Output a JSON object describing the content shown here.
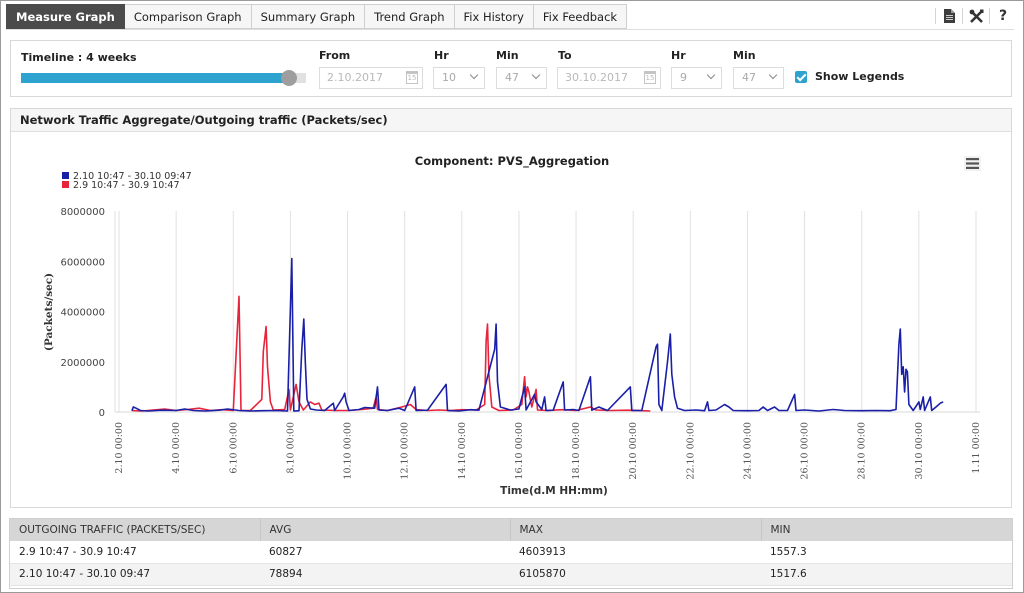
{
  "tabs": [
    {
      "label": "Measure Graph",
      "active": true
    },
    {
      "label": "Comparison Graph",
      "active": false
    },
    {
      "label": "Summary Graph",
      "active": false
    },
    {
      "label": "Trend Graph",
      "active": false
    },
    {
      "label": "Fix History",
      "active": false
    },
    {
      "label": "Fix Feedback",
      "active": false
    }
  ],
  "toolbar": {
    "icons": [
      "document-icon",
      "tools-icon",
      "help-icon"
    ],
    "help_label": "?"
  },
  "timeline": {
    "label": "Timeline : 4 weeks",
    "slider_value_fraction": 0.94,
    "from_label": "From",
    "from_date": "2.10.2017",
    "from_hr_label": "Hr",
    "from_hr": "10",
    "from_min_label": "Min",
    "from_min": "47",
    "to_label": "To",
    "to_date": "30.10.2017",
    "to_hr_label": "Hr",
    "to_hr": "9",
    "to_min_label": "Min",
    "to_min": "47",
    "calendar_day": "15",
    "show_legends_label": "Show Legends",
    "show_legends_checked": true
  },
  "panel": {
    "title": "Network Traffic Aggregate/Outgoing traffic (Packets/sec)"
  },
  "chart_data": {
    "type": "line",
    "title": "Component: PVS_Aggregation",
    "xlabel": "Time(d.M HH:mm)",
    "ylabel": "(Packets/sec)",
    "ylim": [
      0,
      8000000
    ],
    "yticks": [
      "0",
      "2000000",
      "4000000",
      "6000000",
      "8000000"
    ],
    "ytick_values": [
      0,
      2000000,
      4000000,
      6000000,
      8000000
    ],
    "xlim_days": [
      0,
      30.3
    ],
    "xticks": [
      "2.10 00:00",
      "4.10 00:00",
      "6.10 00:00",
      "8.10 00:00",
      "10.10 00:00",
      "12.10 00:00",
      "14.10 00:00",
      "16.10 00:00",
      "18.10 00:00",
      "20.10 00:00",
      "22.10 00:00",
      "24.10 00:00",
      "26.10 00:00",
      "28.10 00:00",
      "30.10 00:00",
      "1.11 00:00"
    ],
    "xtick_days": [
      0,
      2,
      4,
      6,
      8,
      10,
      12,
      14,
      16,
      18,
      20,
      22,
      24,
      26,
      28,
      30
    ],
    "grid": true,
    "legend_position": "top-left",
    "menu_icon": "hamburger-menu-icon",
    "x_units_note": "x values are days offset from 2.10 00:00 on the shared axis",
    "series": [
      {
        "name": "2.10 10:47 - 30.10 09:47",
        "color": "#1a1fa8",
        "points": [
          [
            0.45,
            50000
          ],
          [
            0.5,
            200000
          ],
          [
            0.6,
            150000
          ],
          [
            0.75,
            60000
          ],
          [
            1.0,
            40000
          ],
          [
            1.5,
            70000
          ],
          [
            2.0,
            60000
          ],
          [
            2.3,
            120000
          ],
          [
            2.6,
            60000
          ],
          [
            3.0,
            40000
          ],
          [
            3.5,
            70000
          ],
          [
            3.8,
            120000
          ],
          [
            4.2,
            60000
          ],
          [
            4.6,
            40000
          ],
          [
            5.0,
            50000
          ],
          [
            5.5,
            60000
          ],
          [
            5.9,
            40000
          ],
          [
            6.05,
            6105870
          ],
          [
            6.12,
            40000
          ],
          [
            6.3,
            50000
          ],
          [
            6.4,
            2500000
          ],
          [
            6.47,
            3700000
          ],
          [
            6.52,
            2000000
          ],
          [
            6.58,
            500000
          ],
          [
            6.7,
            120000
          ],
          [
            6.9,
            80000
          ],
          [
            7.2,
            60000
          ],
          [
            7.5,
            350000
          ],
          [
            7.55,
            60000
          ],
          [
            7.85,
            600000
          ],
          [
            7.9,
            750000
          ],
          [
            7.95,
            400000
          ],
          [
            8.05,
            60000
          ],
          [
            8.4,
            100000
          ],
          [
            8.6,
            180000
          ],
          [
            8.95,
            150000
          ],
          [
            9.05,
            1000000
          ],
          [
            9.1,
            80000
          ],
          [
            9.4,
            60000
          ],
          [
            9.8,
            150000
          ],
          [
            10.0,
            60000
          ],
          [
            10.35,
            1000000
          ],
          [
            10.4,
            60000
          ],
          [
            10.8,
            70000
          ],
          [
            11.45,
            1100000
          ],
          [
            11.5,
            60000
          ],
          [
            11.9,
            40000
          ],
          [
            12.3,
            90000
          ],
          [
            12.6,
            70000
          ],
          [
            13.15,
            2500000
          ],
          [
            13.2,
            3500000
          ],
          [
            13.25,
            1200000
          ],
          [
            13.35,
            200000
          ],
          [
            13.7,
            80000
          ],
          [
            14.0,
            120000
          ],
          [
            14.2,
            1000000
          ],
          [
            14.25,
            80000
          ],
          [
            14.45,
            500000
          ],
          [
            14.5,
            600000
          ],
          [
            14.55,
            700000
          ],
          [
            14.6,
            400000
          ],
          [
            14.8,
            100000
          ],
          [
            14.9,
            600000
          ],
          [
            14.95,
            60000
          ],
          [
            15.2,
            70000
          ],
          [
            15.55,
            1200000
          ],
          [
            15.6,
            80000
          ],
          [
            15.9,
            100000
          ],
          [
            16.1,
            60000
          ],
          [
            16.5,
            1400000
          ],
          [
            16.55,
            70000
          ],
          [
            16.8,
            200000
          ],
          [
            16.9,
            150000
          ],
          [
            17.1,
            60000
          ],
          [
            17.9,
            1000000
          ],
          [
            17.95,
            60000
          ],
          [
            18.3,
            60000
          ],
          [
            18.8,
            2600000
          ],
          [
            18.85,
            2700000
          ],
          [
            18.9,
            300000
          ],
          [
            19.0,
            60000
          ],
          [
            19.2,
            2000000
          ],
          [
            19.3,
            3100000
          ],
          [
            19.35,
            1500000
          ],
          [
            19.45,
            600000
          ],
          [
            19.55,
            150000
          ],
          [
            19.8,
            60000
          ],
          [
            20.2,
            80000
          ],
          [
            20.5,
            50000
          ],
          [
            20.6,
            400000
          ],
          [
            20.65,
            60000
          ],
          [
            20.9,
            80000
          ],
          [
            21.2,
            300000
          ],
          [
            21.35,
            200000
          ],
          [
            21.5,
            60000
          ],
          [
            22.0,
            50000
          ],
          [
            22.4,
            60000
          ],
          [
            22.55,
            200000
          ],
          [
            22.7,
            60000
          ],
          [
            22.95,
            200000
          ],
          [
            23.1,
            60000
          ],
          [
            23.4,
            60000
          ],
          [
            23.65,
            700000
          ],
          [
            23.7,
            60000
          ],
          [
            24.0,
            80000
          ],
          [
            24.5,
            40000
          ],
          [
            25.0,
            100000
          ],
          [
            25.4,
            60000
          ],
          [
            26.0,
            50000
          ],
          [
            26.5,
            60000
          ],
          [
            27.0,
            50000
          ],
          [
            27.2,
            100000
          ],
          [
            27.3,
            2700000
          ],
          [
            27.35,
            3300000
          ],
          [
            27.4,
            1500000
          ],
          [
            27.45,
            1800000
          ],
          [
            27.5,
            800000
          ],
          [
            27.55,
            1700000
          ],
          [
            27.6,
            1600000
          ],
          [
            27.65,
            300000
          ],
          [
            27.8,
            60000
          ],
          [
            28.0,
            400000
          ],
          [
            28.05,
            100000
          ],
          [
            28.15,
            600000
          ],
          [
            28.2,
            60000
          ],
          [
            28.4,
            600000
          ],
          [
            28.45,
            60000
          ],
          [
            28.6,
            200000
          ],
          [
            28.75,
            350000
          ],
          [
            28.85,
            400000
          ]
        ]
      },
      {
        "name": "2.9 10:47 - 30.9 10:47",
        "color": "#e8243a",
        "points": [
          [
            0.45,
            60000
          ],
          [
            0.8,
            40000
          ],
          [
            1.2,
            80000
          ],
          [
            1.6,
            120000
          ],
          [
            2.0,
            60000
          ],
          [
            2.4,
            100000
          ],
          [
            2.8,
            150000
          ],
          [
            3.2,
            60000
          ],
          [
            3.6,
            90000
          ],
          [
            4.0,
            60000
          ],
          [
            4.2,
            4603913
          ],
          [
            4.27,
            60000
          ],
          [
            4.6,
            60000
          ],
          [
            5.0,
            500000
          ],
          [
            5.05,
            2400000
          ],
          [
            5.15,
            3400000
          ],
          [
            5.2,
            1800000
          ],
          [
            5.3,
            400000
          ],
          [
            5.4,
            80000
          ],
          [
            5.8,
            100000
          ],
          [
            5.95,
            900000
          ],
          [
            6.0,
            80000
          ],
          [
            6.2,
            1100000
          ],
          [
            6.3,
            400000
          ],
          [
            6.45,
            80000
          ],
          [
            6.7,
            400000
          ],
          [
            6.85,
            300000
          ],
          [
            7.0,
            350000
          ],
          [
            7.1,
            80000
          ],
          [
            7.6,
            60000
          ],
          [
            8.0,
            60000
          ],
          [
            8.5,
            100000
          ],
          [
            8.9,
            150000
          ],
          [
            9.0,
            600000
          ],
          [
            9.05,
            100000
          ],
          [
            9.4,
            60000
          ],
          [
            9.9,
            200000
          ],
          [
            10.2,
            300000
          ],
          [
            10.4,
            100000
          ],
          [
            10.8,
            60000
          ],
          [
            11.2,
            80000
          ],
          [
            11.6,
            60000
          ],
          [
            12.0,
            90000
          ],
          [
            12.5,
            80000
          ],
          [
            12.8,
            300000
          ],
          [
            12.85,
            2800000
          ],
          [
            12.9,
            3500000
          ],
          [
            12.95,
            1500000
          ],
          [
            13.05,
            200000
          ],
          [
            13.3,
            60000
          ],
          [
            13.8,
            80000
          ],
          [
            14.1,
            300000
          ],
          [
            14.2,
            1400000
          ],
          [
            14.25,
            600000
          ],
          [
            14.3,
            1000000
          ],
          [
            14.35,
            800000
          ],
          [
            14.45,
            200000
          ],
          [
            14.6,
            900000
          ],
          [
            14.65,
            80000
          ],
          [
            15.0,
            60000
          ],
          [
            15.5,
            90000
          ],
          [
            16.0,
            60000
          ],
          [
            16.5,
            200000
          ],
          [
            16.7,
            80000
          ],
          [
            17.2,
            60000
          ],
          [
            17.8,
            70000
          ],
          [
            18.2,
            60000
          ],
          [
            18.6,
            40000
          ]
        ]
      }
    ]
  },
  "table": {
    "headers": [
      "OUTGOING TRAFFIC (PACKETS/SEC)",
      "AVG",
      "MAX",
      "MIN"
    ],
    "rows": [
      [
        "2.9 10:47 - 30.9 10:47",
        "60827",
        "4603913",
        "1557.3"
      ],
      [
        "2.10 10:47 - 30.10 09:47",
        "78894",
        "6105870",
        "1517.6"
      ]
    ]
  }
}
